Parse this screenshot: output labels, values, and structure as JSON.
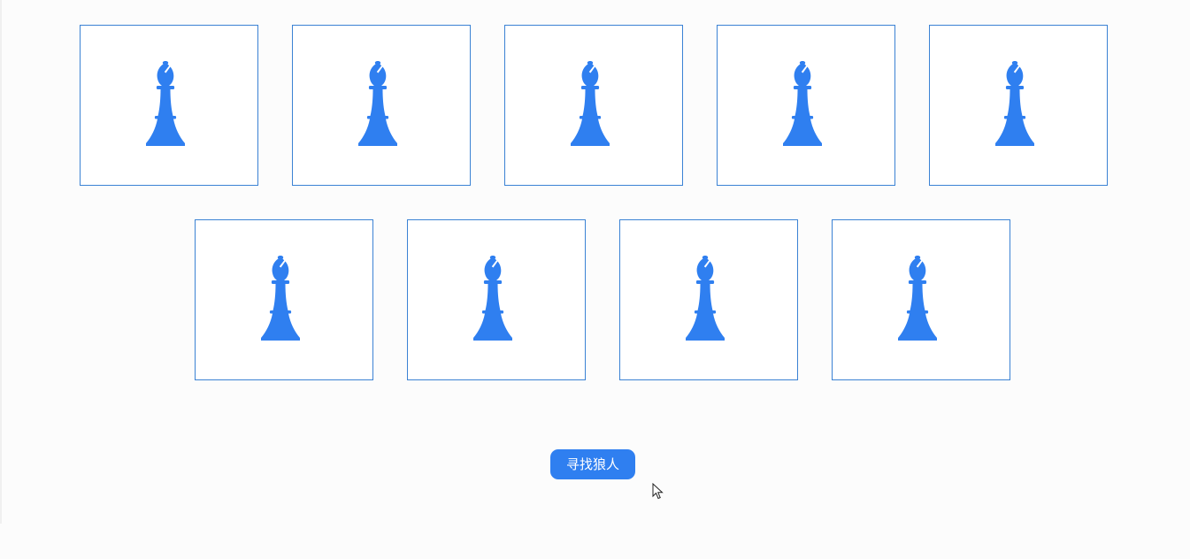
{
  "colors": {
    "accent": "#2f7ff0",
    "card_border": "#3b82d4",
    "page_background": "#fcfcfc"
  },
  "cards": [
    {
      "icon": "chess-bishop-icon"
    },
    {
      "icon": "chess-bishop-icon"
    },
    {
      "icon": "chess-bishop-icon"
    },
    {
      "icon": "chess-bishop-icon"
    },
    {
      "icon": "chess-bishop-icon"
    },
    {
      "icon": "chess-bishop-icon"
    },
    {
      "icon": "chess-bishop-icon"
    },
    {
      "icon": "chess-bishop-icon"
    },
    {
      "icon": "chess-bishop-icon"
    }
  ],
  "action": {
    "find_werewolf_label": "寻找狼人"
  }
}
